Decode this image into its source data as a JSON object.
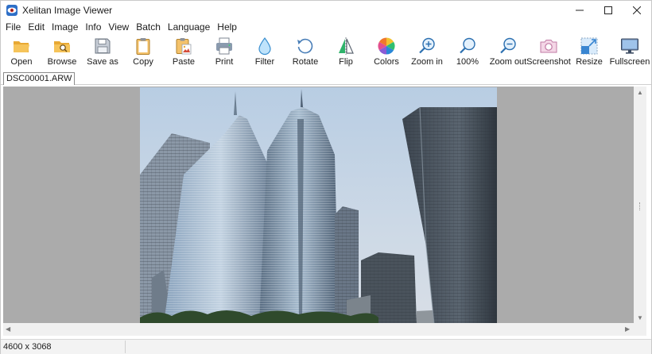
{
  "app": {
    "title": "Xelitan Image Viewer",
    "icon": "eye-app-icon"
  },
  "menu": [
    "File",
    "Edit",
    "Image",
    "Info",
    "View",
    "Batch",
    "Language",
    "Help"
  ],
  "toolbar": [
    {
      "label": "Open",
      "icon": "folder-open-icon"
    },
    {
      "label": "Browse",
      "icon": "folder-search-icon"
    },
    {
      "label": "Save as",
      "icon": "floppy-disk-icon"
    },
    {
      "label": "Copy",
      "icon": "clipboard-copy-icon"
    },
    {
      "label": "Paste",
      "icon": "clipboard-paste-icon"
    },
    {
      "label": "Print",
      "icon": "printer-icon"
    },
    {
      "label": "Filter",
      "icon": "droplet-icon"
    },
    {
      "label": "Rotate",
      "icon": "rotate-icon"
    },
    {
      "label": "Flip",
      "icon": "flip-icon"
    },
    {
      "label": "Colors",
      "icon": "color-wheel-icon"
    },
    {
      "label": "Zoom in",
      "icon": "zoom-in-icon"
    },
    {
      "label": "100%",
      "icon": "magnifier-icon"
    },
    {
      "label": "Zoom out",
      "icon": "zoom-out-icon"
    },
    {
      "label": "Screenshot",
      "icon": "camera-icon"
    },
    {
      "label": "Resize",
      "icon": "resize-icon"
    },
    {
      "label": "Fullscreen",
      "icon": "monitor-icon"
    }
  ],
  "tabs": [
    {
      "label": "DSC00001.ARW",
      "active": true
    }
  ],
  "image": {
    "subject": "city-skyscrapers-photo"
  },
  "status": {
    "dimensions": "4600 x 3068"
  },
  "colors": {
    "viewer_bg": "#ababab",
    "accent": "#2b88d8"
  }
}
